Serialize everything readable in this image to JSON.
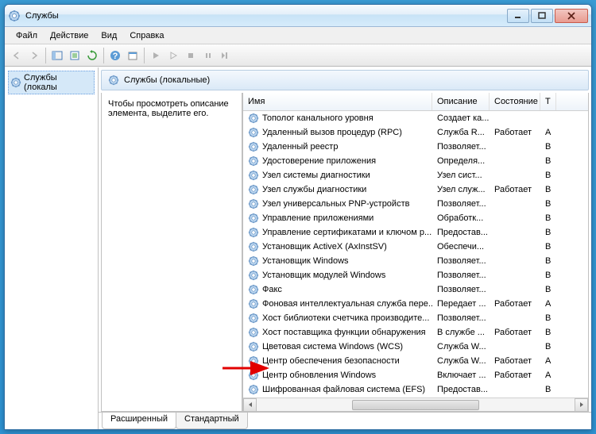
{
  "window": {
    "title": "Службы"
  },
  "menu": {
    "file": "Файл",
    "action": "Действие",
    "view": "Вид",
    "help": "Справка"
  },
  "sidebar": {
    "root": "Службы (локалы"
  },
  "main": {
    "header": "Службы (локальные)",
    "description": "Чтобы просмотреть описание элемента, выделите его.",
    "columns": {
      "name": "Имя",
      "desc": "Описание",
      "state": "Состояние",
      "type": "Т"
    },
    "tabs": {
      "ext": "Расширенный",
      "std": "Стандартный"
    }
  },
  "services": [
    {
      "name": "Тополог канального уровня",
      "desc": "Создает ка...",
      "state": "",
      "type": ""
    },
    {
      "name": "Удаленный вызов процедур (RPC)",
      "desc": "Служба R...",
      "state": "Работает",
      "type": "А"
    },
    {
      "name": "Удаленный реестр",
      "desc": "Позволяет...",
      "state": "",
      "type": "В"
    },
    {
      "name": "Удостоверение приложения",
      "desc": "Определя...",
      "state": "",
      "type": "В"
    },
    {
      "name": "Узел системы диагностики",
      "desc": "Узел сист...",
      "state": "",
      "type": "В"
    },
    {
      "name": "Узел службы диагностики",
      "desc": "Узел служ...",
      "state": "Работает",
      "type": "В"
    },
    {
      "name": "Узел универсальных PNP-устройств",
      "desc": "Позволяет...",
      "state": "",
      "type": "В"
    },
    {
      "name": "Управление приложениями",
      "desc": "Обработк...",
      "state": "",
      "type": "В"
    },
    {
      "name": "Управление сертификатами и ключом р...",
      "desc": "Предостав...",
      "state": "",
      "type": "В"
    },
    {
      "name": "Установщик ActiveX (AxInstSV)",
      "desc": "Обеспечи...",
      "state": "",
      "type": "В"
    },
    {
      "name": "Установщик Windows",
      "desc": "Позволяет...",
      "state": "",
      "type": "В"
    },
    {
      "name": "Установщик модулей Windows",
      "desc": "Позволяет...",
      "state": "",
      "type": "В"
    },
    {
      "name": "Факс",
      "desc": "Позволяет...",
      "state": "",
      "type": "В"
    },
    {
      "name": "Фоновая интеллектуальная служба пере...",
      "desc": "Передает ...",
      "state": "Работает",
      "type": "А"
    },
    {
      "name": "Хост библиотеки счетчика производите...",
      "desc": "Позволяет...",
      "state": "",
      "type": "В"
    },
    {
      "name": "Хост поставщика функции обнаружения",
      "desc": "В службе ...",
      "state": "Работает",
      "type": "В"
    },
    {
      "name": "Цветовая система Windows (WCS)",
      "desc": "Служба W...",
      "state": "",
      "type": "В"
    },
    {
      "name": "Центр обеспечения безопасности",
      "desc": "Служба W...",
      "state": "Работает",
      "type": "А"
    },
    {
      "name": "Центр обновления Windows",
      "desc": "Включает ...",
      "state": "Работает",
      "type": "А"
    },
    {
      "name": "Шифрованная файловая система (EFS)",
      "desc": "Предостав...",
      "state": "",
      "type": "В"
    }
  ]
}
